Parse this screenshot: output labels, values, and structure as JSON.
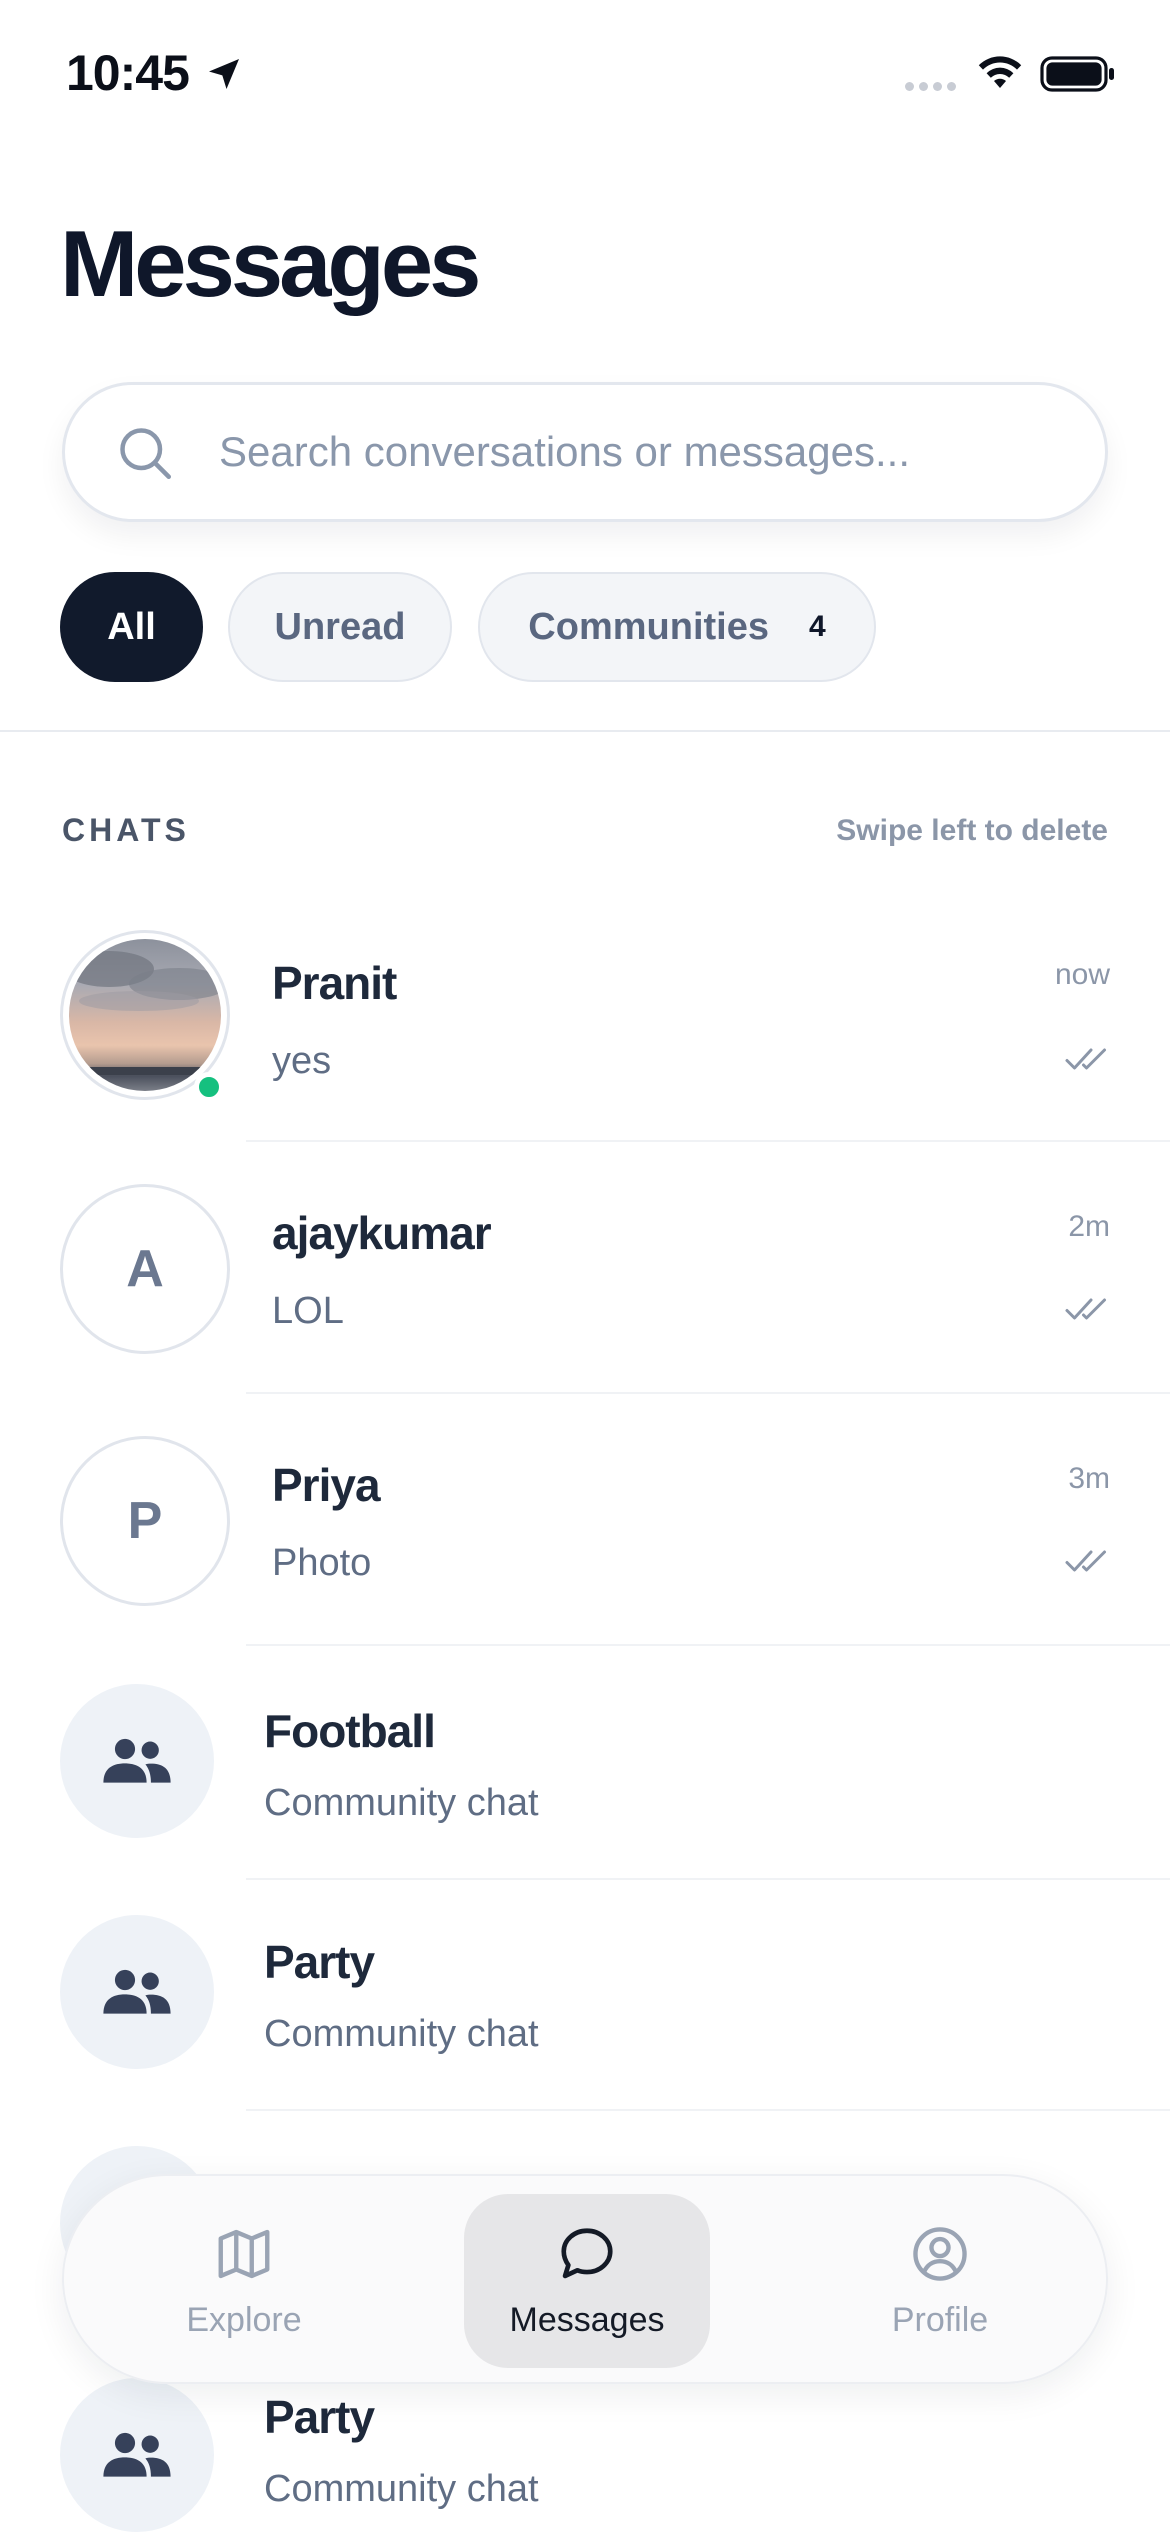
{
  "status_bar": {
    "time": "10:45"
  },
  "page": {
    "title": "Messages"
  },
  "search": {
    "placeholder": "Search conversations or messages...",
    "value": ""
  },
  "filters": {
    "all": "All",
    "unread": "Unread",
    "communities": "Communities",
    "communities_count": "4",
    "selected": "All"
  },
  "section": {
    "title": "CHATS",
    "hint": "Swipe left to delete"
  },
  "chats": [
    {
      "name": "Pranit",
      "preview": "yes",
      "time": "now",
      "online": true,
      "avatar": "photo"
    },
    {
      "name": "ajaykumar",
      "preview": "LOL",
      "time": "2m",
      "avatar_letter": "A"
    },
    {
      "name": "Priya",
      "preview": "Photo",
      "time": "3m",
      "avatar_letter": "P"
    }
  ],
  "communities": [
    {
      "name": "Football",
      "preview": "Community chat"
    },
    {
      "name": "Party",
      "preview": "Community chat"
    },
    {
      "name": "Party",
      "preview": "Community chat"
    }
  ],
  "nav": {
    "explore": "Explore",
    "messages": "Messages",
    "profile": "Profile",
    "active": "Messages"
  },
  "colors": {
    "primary_dark": "#111a2c",
    "online_green": "#15c07f",
    "muted_text": "#8b96a8"
  }
}
